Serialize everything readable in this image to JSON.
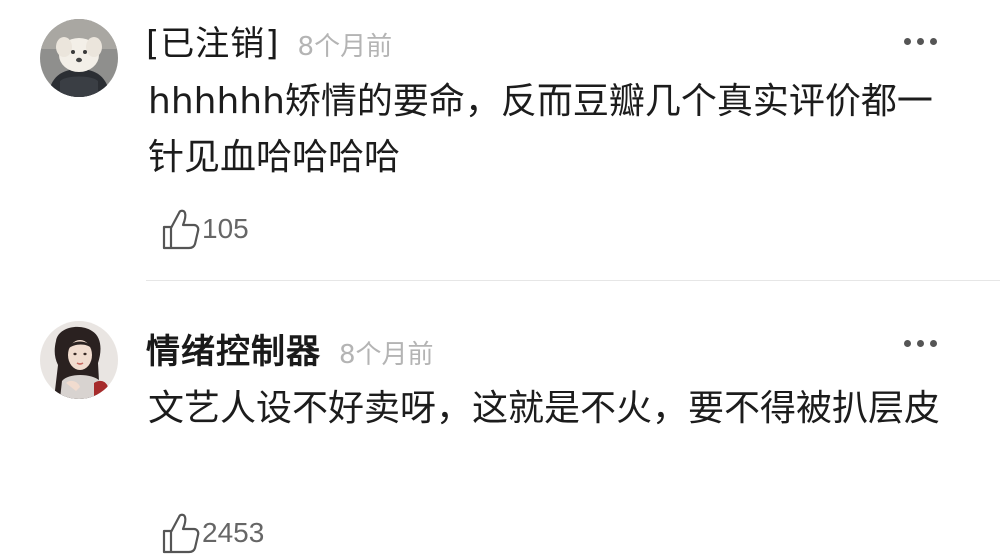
{
  "comments": [
    {
      "username": "[已注销]",
      "time": "8个月前",
      "text": "hhhhhh矫情的要命，反而豆瓣几个真实评价都一针见血哈哈哈哈",
      "likes": "105",
      "avatar_icon": "dog-avatar-icon"
    },
    {
      "username": "情绪控制器",
      "time": "8个月前",
      "text": "文艺人设不好卖呀，这就是不火，要不得被扒层皮",
      "likes": "2453",
      "avatar_icon": "woman-portrait-avatar-icon"
    }
  ],
  "icons": {
    "like": "thumbs-up-icon",
    "more": "more-dots-icon"
  },
  "colors": {
    "time": "#b4b4b4",
    "divider": "#e6e6e6",
    "like_count": "#666666"
  }
}
